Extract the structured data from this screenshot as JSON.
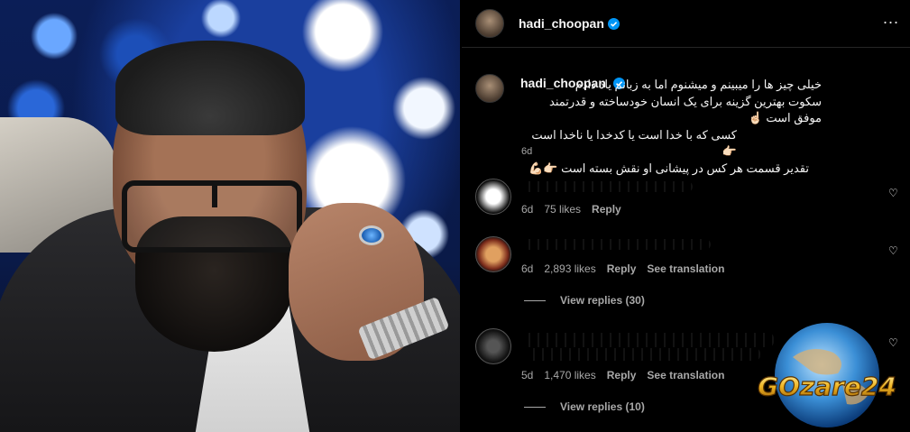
{
  "post": {
    "username": "hadi_choopan",
    "caption_username": "hadi_choopan",
    "caption_lines": [
      "خیلی چیز ها را میبینم و میشنوم اما به زبانم یاد دادم",
      "سکوت بهترین گزینه برای یک انسان خودساخته و قدرتمند موفق است ☝🏻",
      "کسی که با خدا است یا کدخدا یا ناخدا است 👉🏻",
      "تقدیر قسمت هر کس در پیشانی او نقش بسته است 👉🏻💪🏻"
    ],
    "caption_time": "6d",
    "more_label": "..."
  },
  "comments": [
    {
      "time": "6d",
      "likes": "75 likes",
      "reply": "Reply",
      "translation": ""
    },
    {
      "time": "6d",
      "likes": "2,893 likes",
      "reply": "Reply",
      "translation": "See translation",
      "view_replies": "View replies (30)"
    },
    {
      "time": "5d",
      "likes": "1,470 likes",
      "reply": "Reply",
      "translation": "See translation",
      "view_replies": "View replies (10)"
    }
  ],
  "watermark": {
    "text": "GOzare24"
  },
  "colors": {
    "verified": "#0095f6",
    "meta": "#a8a8a8",
    "background": "#000000"
  },
  "icons": [
    "verified-badge-icon",
    "heart-icon",
    "more-options-icon"
  ]
}
